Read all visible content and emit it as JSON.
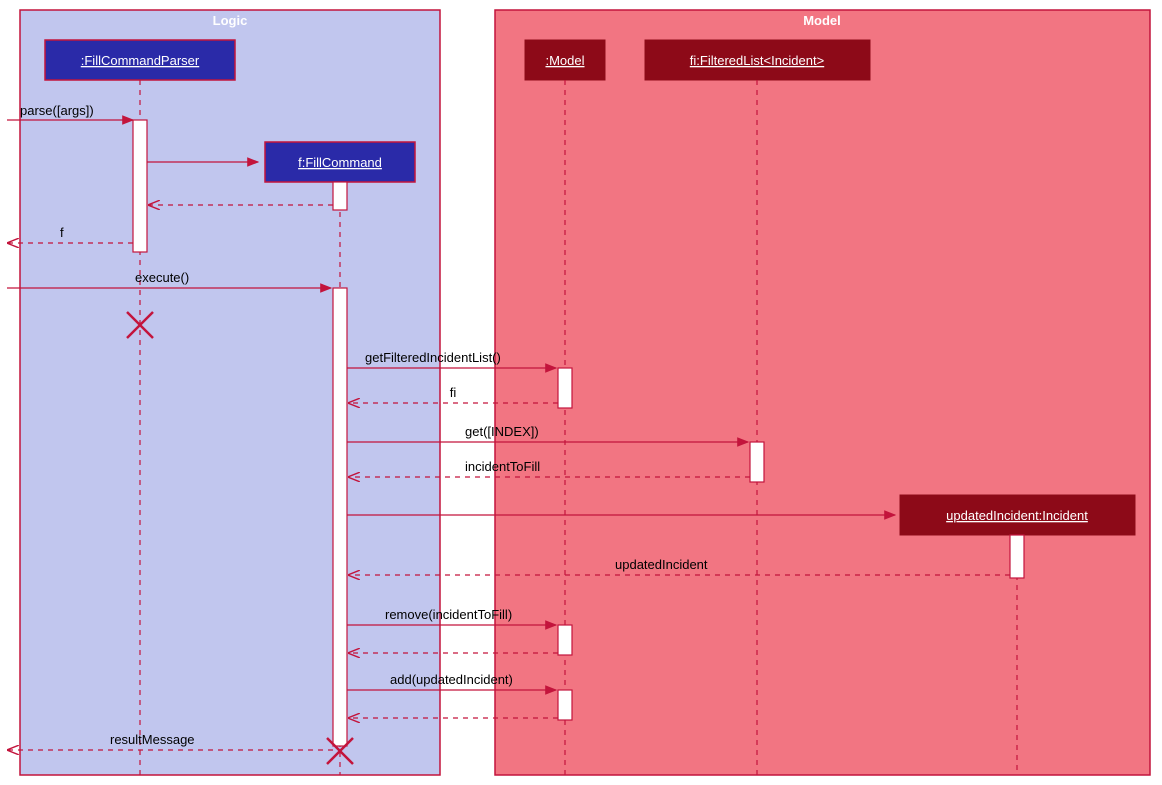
{
  "boxes": {
    "logic": {
      "label": "Logic"
    },
    "model": {
      "label": "Model"
    }
  },
  "participants": {
    "parser": {
      "label": ":FillCommandParser"
    },
    "command": {
      "label": "f:FillCommand"
    },
    "model": {
      "label": ":Model"
    },
    "filteredList": {
      "label": "fi:FilteredList<Incident>"
    },
    "incident": {
      "label": "updatedIncident:Incident"
    }
  },
  "messages": {
    "parse": "parse([args])",
    "f_return": "f",
    "execute": "execute()",
    "getFiltered": "getFilteredIncidentList()",
    "fi_return": "fi",
    "getIndex": "get([INDEX])",
    "incidentToFill": "incidentToFill",
    "updatedIncident_return": "updatedIncident",
    "remove": "remove(incidentToFill)",
    "add": "add(updatedIncident)",
    "resultMessage": "resultMessage"
  },
  "colors": {
    "logicBg": "#c1c6ee",
    "modelBg": "#f27582",
    "lifelineBox": "#2a2aa8",
    "stroke": "#c3143c",
    "redBox": "#8d0a18"
  }
}
